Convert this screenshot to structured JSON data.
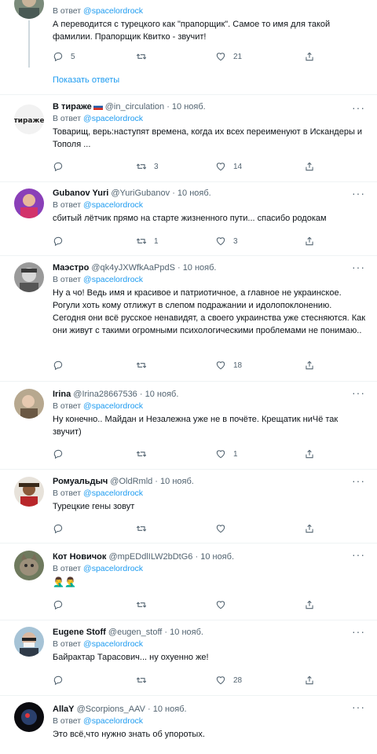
{
  "replying_label": "В ответ",
  "show_replies_label": "Показать ответы",
  "colors": {
    "accent": "#1d9bf0",
    "muted": "#536471",
    "text": "#0f1419",
    "divider": "#eff3f4"
  },
  "icons": [
    "reply-icon",
    "retweet-icon",
    "like-icon",
    "share-icon",
    "more-icon"
  ],
  "tweets": [
    {
      "name": "",
      "handle": "",
      "date": "",
      "reply_to": "@spacelordrock",
      "text": "А переводится с турецкого как \"прапорщик\". Самое то имя для такой фамилии. Прапорщик Квитко - звучит!",
      "replies": "5",
      "retweets": "",
      "likes": "21"
    },
    {
      "name": "В тираже",
      "handle": "@in_circulation",
      "date": "10 нояб.",
      "reply_to": "@spacelordrock",
      "text": "Товарищ, верь:наступят времена, когда их всех переименуют в Искандеры и Тополя ...",
      "replies": "",
      "retweets": "3",
      "likes": "14"
    },
    {
      "name": "Gubanov Yuri",
      "handle": "@YuriGubanov",
      "date": "10 нояб.",
      "reply_to": "@spacelordrock",
      "text": "сбитый лётчик прямо на старте жизненного пути... спасибо родокам",
      "replies": "",
      "retweets": "1",
      "likes": "3"
    },
    {
      "name": "Маэстро",
      "handle": "@qk4yJXWfkAaPpdS",
      "date": "10 нояб.",
      "reply_to": "@spacelordrock",
      "text": "Ну а чо! Ведь имя и красивое и патриотичное, а главное не украинское. Рогули хоть кому отлижут в слепом подражании и идолопоклонению. Сегодня они всё русское ненавидят, а своего украинства уже стесняются. Как они живут с такими огромными психологическими проблемами не понимаю..",
      "replies": "",
      "retweets": "",
      "likes": "18"
    },
    {
      "name": "Irina",
      "handle": "@Irina28667536",
      "date": "10 нояб.",
      "reply_to": "@spacelordrock",
      "text": "Ну конечно.. Майдан и Незалежна уже не в почёте. Крещатик ниЧё так звучит)",
      "replies": "",
      "retweets": "",
      "likes": "1"
    },
    {
      "name": "Ромуальдыч",
      "handle": "@OldRmld",
      "date": "10 нояб.",
      "reply_to": "@spacelordrock",
      "text": "Турецкие гены зовут",
      "replies": "",
      "retweets": "",
      "likes": ""
    },
    {
      "name": "Кот Новичок",
      "handle": "@mpEDdlILW2bDtG6",
      "date": "10 нояб.",
      "reply_to": "@spacelordrock",
      "text": "🤦‍♂️🤦‍♂️",
      "replies": "",
      "retweets": "",
      "likes": ""
    },
    {
      "name": "Eugene Stoff",
      "handle": "@eugen_stoff",
      "date": "10 нояб.",
      "reply_to": "@spacelordrock",
      "text": "Байрактар Тарасович... ну охуенно же!",
      "replies": "",
      "retweets": "",
      "likes": "28"
    },
    {
      "name": "AllaY",
      "handle": "@Scorpions_AAV",
      "date": "10 нояб.",
      "reply_to": "@spacelordrock",
      "text": "Это всё,что нужно знать об упоротых.",
      "replies": "",
      "retweets": "",
      "likes": ""
    }
  ]
}
